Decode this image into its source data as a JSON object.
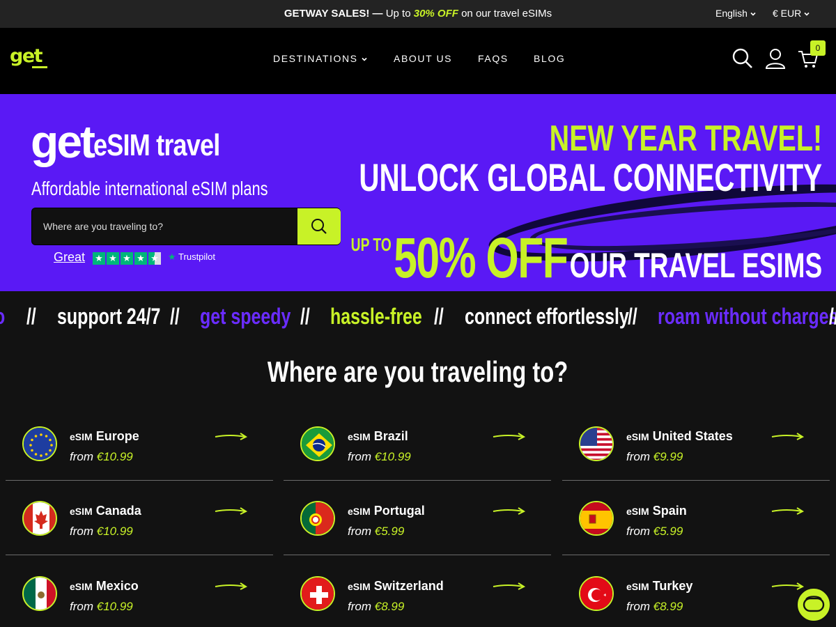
{
  "topbar": {
    "promo_bold": "GETWAY SALES! —",
    "promo_pre": " Up to ",
    "promo_accent": "30% OFF",
    "promo_post": " on our travel eSIMs",
    "language": "English",
    "currency": "€ EUR"
  },
  "header": {
    "logo": "get",
    "nav": [
      "DESTINATIONS",
      "ABOUT US",
      "FAQS",
      "BLOG"
    ],
    "cart_count": "0",
    "icons": [
      "search-icon",
      "user-icon",
      "cart-icon"
    ]
  },
  "hero": {
    "brand_get": "get",
    "brand_rest": "eSIM travel",
    "subtitle": "Affordable international eSIM plans",
    "search_placeholder": "Where are you traveling to?",
    "trust_rating": "Great",
    "trust_stars": 4.5,
    "trust_brand": "Trustpilot",
    "promo_line1": "NEW YEAR TRAVEL!",
    "promo_line2": "UNLOCK GLOBAL CONNECTIVITY",
    "promo_upto": "UP TO",
    "promo_big": "50% OFF",
    "promo_rest": "OUR TRAVEL ESIMS"
  },
  "marquee": {
    "separator": "//",
    "partial": "o",
    "items": [
      "support 24/7",
      "get speedy",
      "hassle-free",
      "connect effortlessly",
      "roam without charges"
    ]
  },
  "destinations": {
    "title": "Where are you traveling to?",
    "esim_label": "eSIM",
    "from_label": "from",
    "items": [
      {
        "country": "Europe",
        "price": "€10.99"
      },
      {
        "country": "Brazil",
        "price": "€10.99"
      },
      {
        "country": "United States",
        "price": "€9.99"
      },
      {
        "country": "Canada",
        "price": "€10.99"
      },
      {
        "country": "Portugal",
        "price": "€5.99"
      },
      {
        "country": "Spain",
        "price": "€5.99"
      },
      {
        "country": "Mexico",
        "price": "€10.99"
      },
      {
        "country": "Switzerland",
        "price": "€8.99"
      },
      {
        "country": "Turkey",
        "price": "€8.99"
      }
    ]
  },
  "colors": {
    "accent": "#c8f227",
    "hero_purple": "#5a19f5",
    "background": "#121212"
  }
}
